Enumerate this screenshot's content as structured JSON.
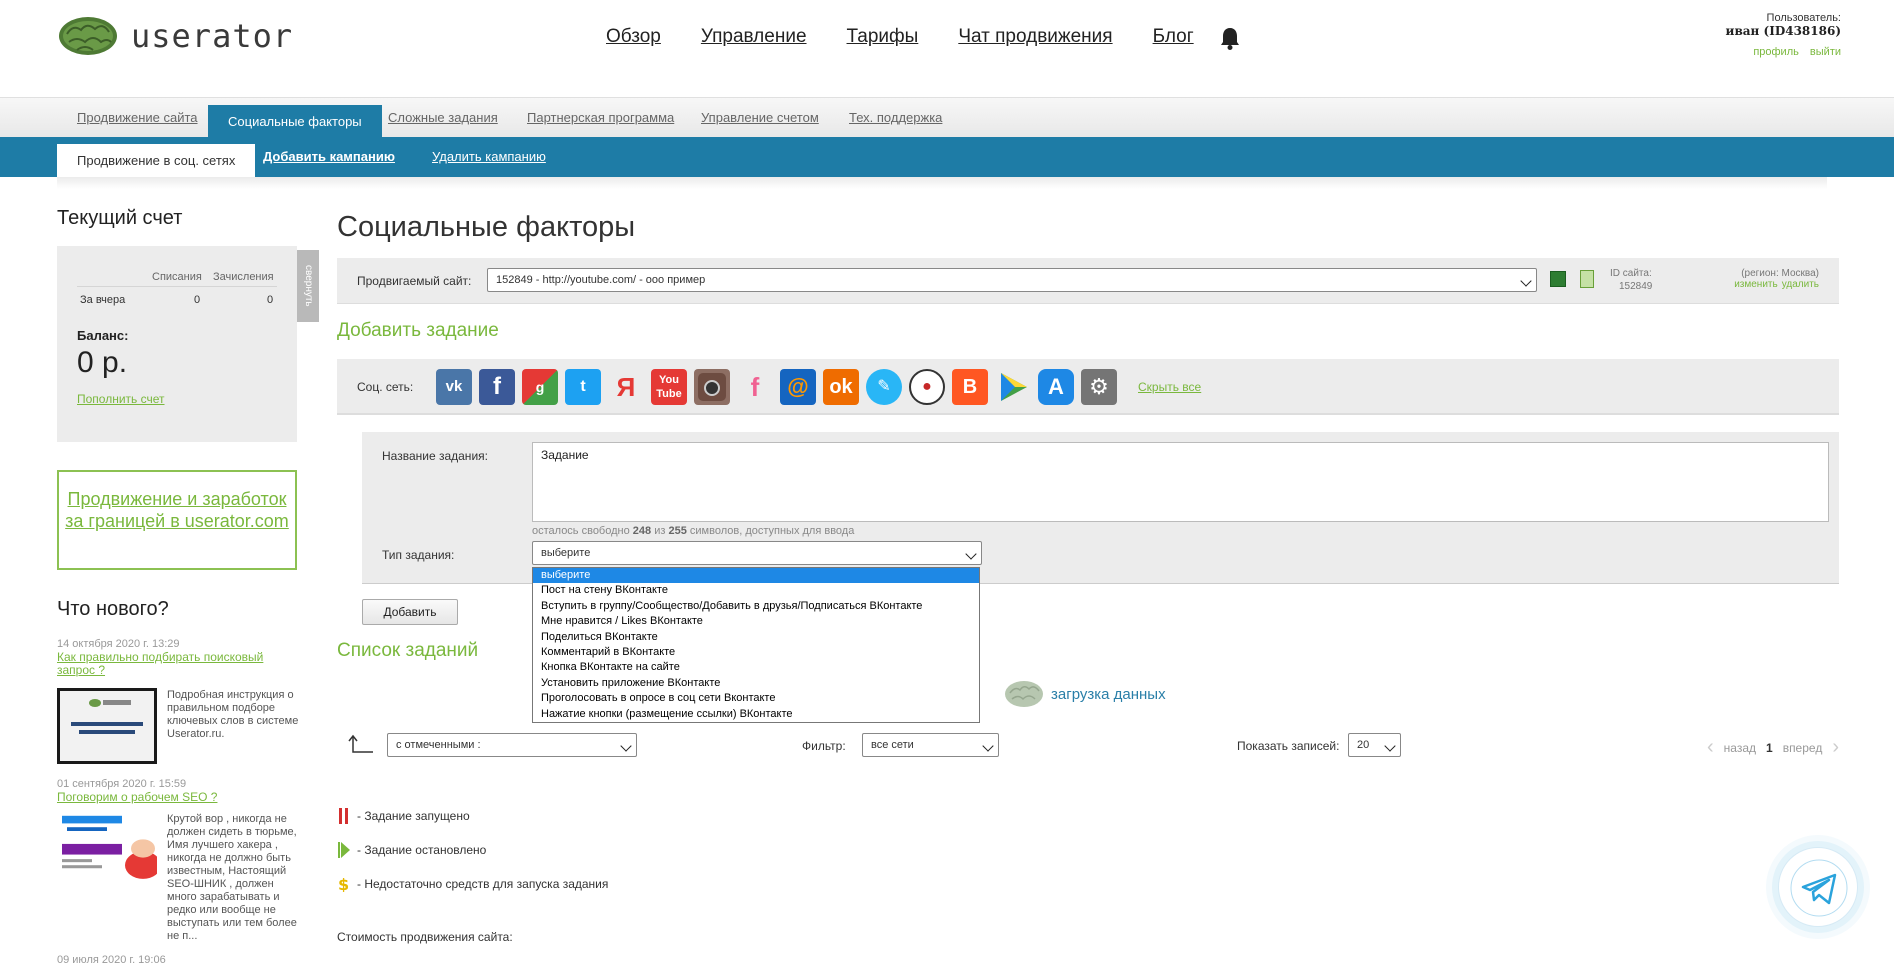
{
  "header": {
    "logo_text": "userator",
    "nav": [
      "Обзор",
      "Управление",
      "Тарифы",
      "Чат продвижения",
      "Блог"
    ],
    "user_label": "Пользователь:",
    "user_name": "иван (ID438186)",
    "profile_link": "профиль",
    "logout_link": "выйти"
  },
  "tabs": {
    "items": [
      "Продвижение сайта",
      "Социальные факторы",
      "Сложные задания",
      "Партнерская программа",
      "Управление счетом",
      "Тех. поддержка"
    ],
    "active": 1
  },
  "subtabs": {
    "items": [
      "Продвижение в соц. сетях",
      "Добавить кампанию",
      "Удалить кампанию"
    ]
  },
  "sidebar": {
    "account_title": "Текущий счет",
    "collapse_label": "свернуть",
    "col_debits": "Списания",
    "col_credits": "Зачисления",
    "row_label": "За вчера",
    "row_debits": "0",
    "row_credits": "0",
    "balance_label": "Баланс:",
    "balance_value": "0 р.",
    "topup_link": "Пополнить счет",
    "promo_text": "Продвижение и заработок за границей в userator.com",
    "news_title": "Что нового?",
    "news": [
      {
        "date": "14 октября 2020 г. 13:29",
        "title": "Как правильно подбирать поисковый запрос ?",
        "text": "Подробная инструкция о правильном подборе ключевых слов в системе Userator.ru."
      },
      {
        "date": "01 сентября 2020 г. 15:59",
        "title": "Поговорим о рабочем SEO ?",
        "text": "Крутой вор , никогда не должен сидеть в тюрьме, Имя лучшего хакера , никогда не должно быть известным, Настоящий SEO-ШНИК , должен много зарабатывать и редко или вообще не выступать или тем более не п..."
      },
      {
        "date": "09 июля 2020 г. 19:06",
        "title": "",
        "text": ""
      }
    ]
  },
  "main": {
    "title": "Социальные факторы",
    "site_label": "Продвигаемый сайт:",
    "site_value": "152849 - http://youtube.com/ - ооо пример",
    "site_id_label": "ID сайта:",
    "site_id": "152849",
    "region": "(регион: Москва)",
    "edit_link": "изменить",
    "delete_link": "удалить",
    "add_task_title": "Добавить задание",
    "social_label": "Соц. сеть:",
    "social_icons": [
      "vk-icon",
      "facebook-icon",
      "google-plus-icon",
      "twitter-icon",
      "yandex-icon",
      "youtube-icon",
      "instagram-icon",
      "foursquare-icon",
      "mailru-icon",
      "odnoklassniki-icon",
      "livejournal-icon",
      "liveinternet-icon",
      "blogger-icon",
      "google-play-icon",
      "app-store-icon",
      "settings-app-icon"
    ],
    "hide_all": "Скрыть все",
    "task_name_label": "Название задания:",
    "task_name_value": "Задание",
    "hint_prefix": "осталось свободно",
    "hint_free": "248",
    "hint_of": "из",
    "hint_total": "255",
    "hint_suffix": "символов, доступных для ввода",
    "task_type_label": "Тип задания:",
    "task_type_value": "выберите",
    "task_type_options": [
      "выберите",
      "Пост на стену ВКонтакте",
      "Вступить в группу/Сообщество/Добавить в друзья/Подписаться ВКонтакте",
      "Мне нравится / Likes ВКонтакте",
      "Поделиться ВКонтакте",
      "Комментарий в ВКонтакте",
      "Кнопка ВКонтакте на сайте",
      "Установить приложение ВКонтакте",
      "Проголосовать в опросе в соц сети Вконтакте",
      "Нажатие кнопки (размещение ссылки) ВКонтакте"
    ],
    "add_button": "Добавить",
    "task_list_title": "Список заданий",
    "loading_text": "загрузка данных",
    "marked_select": "с отмеченными :",
    "filter_label": "Фильтр:",
    "filter_value": "все сети",
    "show_label": "Показать записей:",
    "show_value": "20",
    "pager_prev": "назад",
    "pager_current": "1",
    "pager_next": "вперед",
    "legend_running": "- Задание запущено",
    "legend_stopped": "- Задание остановлено",
    "legend_funds": "- Недостаточно средств для запуска задания",
    "cost_label": "Стоимость продвижения сайта:"
  },
  "colors": {
    "accent_blue": "#1e7ca6",
    "accent_green": "#7ab83d"
  }
}
